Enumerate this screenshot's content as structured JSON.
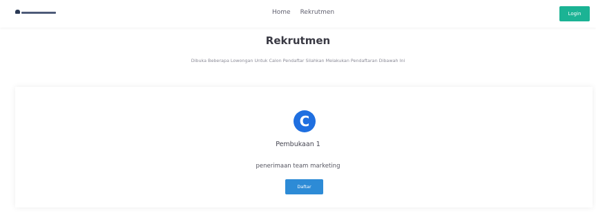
{
  "nav": {
    "links": [
      "Home",
      "Rekrutmen"
    ],
    "login_label": "Login"
  },
  "main": {
    "title": "Rekrutmen",
    "subtitle": "Dibuka Beberapa Lowongan Untuk Calon Pendaftar Silahkan Melakukan Pendaftaran Dibawah Ini"
  },
  "card": {
    "icon": "c-logo-icon",
    "title": "Pembukaan 1",
    "description": "penerimaan team marketing",
    "button_label": "Daftar"
  },
  "colors": {
    "login_button": "#1bb394",
    "daftar_button": "#2d8bd6",
    "icon": "#1f6fe0"
  }
}
